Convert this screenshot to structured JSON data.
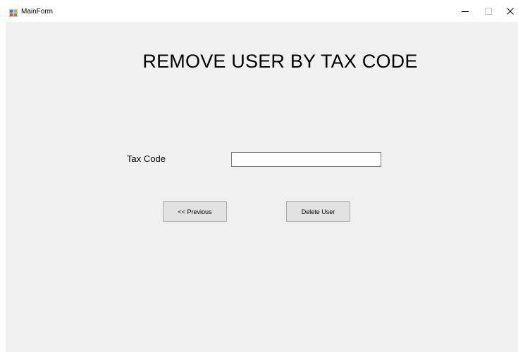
{
  "window": {
    "title": "MainForm",
    "icons": {
      "app": "winforms-app-icon",
      "minimize": "minimize-icon",
      "maximize": "maximize-icon",
      "close": "close-icon"
    }
  },
  "form": {
    "heading": "REMOVE USER BY TAX CODE",
    "tax_code_label": "Tax Code",
    "tax_code_value": "",
    "previous_label": "<< Previous",
    "delete_label": "Delete User"
  },
  "colors": {
    "client_background": "#f0f0f0",
    "button_background": "#e1e1e1",
    "button_border": "#adadad",
    "input_border": "#7a7a7a"
  }
}
